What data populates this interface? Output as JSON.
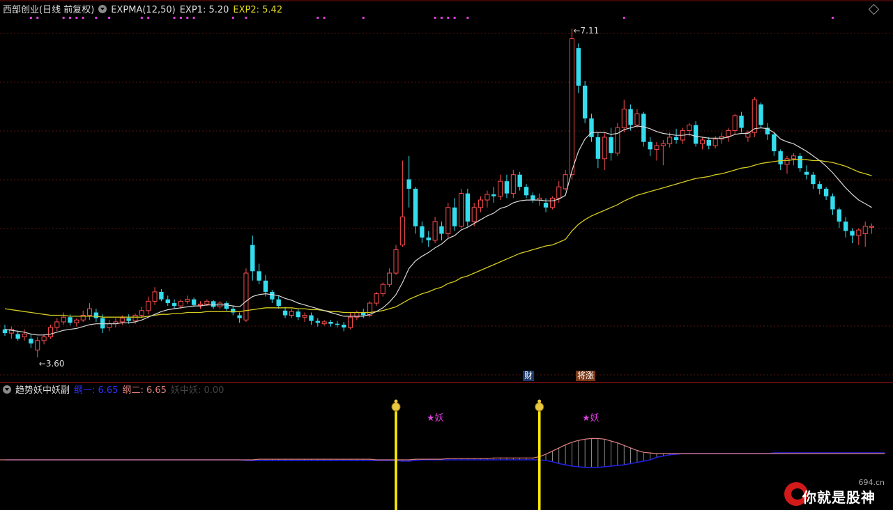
{
  "main_panel": {
    "title": "西部创业(日线 前复权)",
    "indicator_name": "EXPMA(12,50)",
    "exp1_label": "EXP1: 5.20",
    "exp2_label": "EXP2: 5.42",
    "high_label": "7.11",
    "low_label": "3.60",
    "tags": [
      {
        "text": "财"
      },
      {
        "text": "将涨"
      }
    ]
  },
  "sub_panel": {
    "title": "趋势妖中妖副",
    "line1_label": "纲一: 6.65",
    "line2_label": "纲二: 6.65",
    "line3_label": "妖中妖: 0.00",
    "signals": [
      {
        "text": "★妖"
      },
      {
        "text": "★妖"
      }
    ]
  },
  "watermark": {
    "text": "你就是股神",
    "site": "694.cn"
  },
  "colors": {
    "up": "#ff4d4d",
    "down": "#33ddee",
    "exp1": "#d8d8d8",
    "exp2": "#d4cc20",
    "signal": "#ffea00",
    "accent_magenta": "#e040e0",
    "line1": "#2020e0",
    "line2": "#e08080"
  },
  "icons": [
    "collapse-circle-icon",
    "diamond-icon",
    "money-bag-icon"
  ],
  "chart_data": {
    "type": "candlestick",
    "price_range": [
      3.4,
      7.25
    ],
    "candles": [
      [
        3.9,
        3.95,
        3.83,
        3.86
      ],
      [
        3.86,
        3.93,
        3.8,
        3.9
      ],
      [
        3.85,
        3.88,
        3.78,
        3.8
      ],
      [
        3.82,
        3.9,
        3.78,
        3.85
      ],
      [
        3.8,
        3.85,
        3.7,
        3.75
      ],
      [
        3.68,
        3.82,
        3.6,
        3.78
      ],
      [
        3.78,
        3.85,
        3.74,
        3.82
      ],
      [
        3.82,
        3.95,
        3.8,
        3.92
      ],
      [
        3.92,
        4.02,
        3.88,
        3.98
      ],
      [
        3.98,
        4.08,
        3.95,
        4.03
      ],
      [
        4.03,
        4.06,
        3.94,
        3.97
      ],
      [
        3.97,
        4.02,
        3.93,
        4.0
      ],
      [
        4.0,
        4.1,
        3.98,
        4.05
      ],
      [
        4.05,
        4.18,
        4.0,
        4.12
      ],
      [
        4.08,
        4.12,
        3.98,
        4.02
      ],
      [
        4.02,
        4.06,
        3.86,
        3.91
      ],
      [
        3.92,
        4.0,
        3.88,
        3.96
      ],
      [
        3.96,
        4.02,
        3.92,
        3.98
      ],
      [
        3.98,
        4.05,
        3.95,
        4.02
      ],
      [
        4.02,
        4.06,
        3.96,
        3.99
      ],
      [
        3.99,
        4.07,
        3.96,
        4.05
      ],
      [
        4.05,
        4.14,
        4.02,
        4.1
      ],
      [
        4.1,
        4.25,
        4.06,
        4.2
      ],
      [
        4.2,
        4.35,
        4.16,
        4.3
      ],
      [
        4.3,
        4.33,
        4.2,
        4.22
      ],
      [
        4.22,
        4.26,
        4.15,
        4.18
      ],
      [
        4.18,
        4.22,
        4.12,
        4.15
      ],
      [
        4.15,
        4.22,
        4.12,
        4.2
      ],
      [
        4.2,
        4.26,
        4.17,
        4.22
      ],
      [
        4.22,
        4.24,
        4.14,
        4.16
      ],
      [
        4.16,
        4.2,
        4.12,
        4.17
      ],
      [
        4.17,
        4.22,
        4.15,
        4.2
      ],
      [
        4.2,
        4.21,
        4.12,
        4.14
      ],
      [
        4.14,
        4.2,
        4.12,
        4.18
      ],
      [
        4.18,
        4.2,
        4.1,
        4.12
      ],
      [
        4.12,
        4.15,
        4.05,
        4.08
      ],
      [
        4.05,
        4.08,
        3.97,
        4.02
      ],
      [
        4.0,
        4.55,
        3.98,
        4.5
      ],
      [
        4.8,
        4.9,
        4.42,
        4.52
      ],
      [
        4.52,
        4.6,
        4.38,
        4.42
      ],
      [
        4.42,
        4.48,
        4.25,
        4.3
      ],
      [
        4.3,
        4.32,
        4.18,
        4.22
      ],
      [
        4.22,
        4.26,
        4.12,
        4.15
      ],
      [
        4.1,
        4.14,
        4.02,
        4.05
      ],
      [
        4.05,
        4.12,
        4.02,
        4.09
      ],
      [
        4.09,
        4.12,
        4.0,
        4.03
      ],
      [
        4.03,
        4.08,
        3.98,
        4.05
      ],
      [
        4.05,
        4.08,
        3.95,
        3.99
      ],
      [
        3.99,
        4.02,
        3.93,
        3.97
      ],
      [
        3.96,
        4.0,
        3.94,
        3.98
      ],
      [
        3.98,
        4.0,
        3.93,
        3.96
      ],
      [
        3.96,
        3.99,
        3.92,
        3.95
      ],
      [
        3.95,
        3.98,
        3.88,
        3.92
      ],
      [
        3.92,
        4.08,
        3.9,
        4.03
      ],
      [
        4.03,
        4.1,
        4.0,
        4.08
      ],
      [
        4.08,
        4.12,
        4.02,
        4.05
      ],
      [
        4.05,
        4.2,
        4.03,
        4.18
      ],
      [
        4.18,
        4.3,
        4.15,
        4.28
      ],
      [
        4.28,
        4.4,
        4.25,
        4.38
      ],
      [
        4.38,
        4.55,
        4.35,
        4.5
      ],
      [
        4.5,
        4.8,
        4.48,
        4.75
      ],
      [
        4.8,
        5.7,
        4.78,
        5.1
      ],
      [
        5.5,
        5.75,
        5.2,
        5.4
      ],
      [
        5.4,
        5.42,
        4.92,
        5.0
      ],
      [
        5.0,
        5.05,
        4.82,
        4.88
      ],
      [
        4.88,
        4.95,
        4.78,
        4.85
      ],
      [
        4.85,
        5.1,
        4.82,
        5.05
      ],
      [
        5.0,
        5.05,
        4.85,
        4.92
      ],
      [
        4.92,
        5.25,
        4.88,
        5.2
      ],
      [
        5.2,
        5.3,
        4.95,
        5.0
      ],
      [
        5.0,
        5.4,
        4.98,
        5.35
      ],
      [
        5.35,
        5.4,
        5.0,
        5.05
      ],
      [
        5.05,
        5.25,
        5.0,
        5.2
      ],
      [
        5.2,
        5.32,
        5.15,
        5.28
      ],
      [
        5.28,
        5.38,
        5.2,
        5.34
      ],
      [
        5.34,
        5.42,
        5.25,
        5.32
      ],
      [
        5.32,
        5.55,
        5.28,
        5.48
      ],
      [
        5.48,
        5.55,
        5.3,
        5.35
      ],
      [
        5.35,
        5.6,
        5.3,
        5.55
      ],
      [
        5.55,
        5.58,
        5.38,
        5.42
      ],
      [
        5.42,
        5.45,
        5.3,
        5.33
      ],
      [
        5.33,
        5.36,
        5.25,
        5.28
      ],
      [
        5.28,
        5.35,
        5.22,
        5.3
      ],
      [
        5.25,
        5.3,
        5.15,
        5.2
      ],
      [
        5.2,
        5.32,
        5.18,
        5.3
      ],
      [
        5.3,
        5.48,
        5.25,
        5.42
      ],
      [
        5.4,
        5.6,
        5.38,
        5.55
      ],
      [
        5.55,
        7.11,
        5.5,
        7.0
      ],
      [
        6.9,
        6.95,
        6.42,
        6.5
      ],
      [
        6.5,
        6.55,
        6.1,
        6.15
      ],
      [
        6.15,
        6.2,
        5.9,
        5.95
      ],
      [
        5.95,
        6.0,
        5.62,
        5.72
      ],
      [
        5.72,
        6.0,
        5.6,
        5.95
      ],
      [
        5.95,
        6.05,
        5.7,
        5.78
      ],
      [
        5.78,
        6.1,
        5.75,
        6.05
      ],
      [
        6.05,
        6.35,
        6.0,
        6.25
      ],
      [
        6.25,
        6.3,
        6.02,
        6.08
      ],
      [
        6.08,
        6.25,
        6.05,
        6.2
      ],
      [
        6.2,
        6.22,
        5.85,
        5.9
      ],
      [
        5.9,
        5.95,
        5.75,
        5.82
      ],
      [
        5.82,
        5.9,
        5.7,
        5.86
      ],
      [
        5.86,
        5.92,
        5.65,
        5.88
      ],
      [
        5.88,
        6.0,
        5.84,
        5.95
      ],
      [
        5.95,
        6.04,
        5.88,
        5.92
      ],
      [
        5.92,
        6.05,
        5.88,
        6.02
      ],
      [
        6.02,
        6.1,
        5.96,
        6.08
      ],
      [
        6.08,
        6.12,
        5.85,
        5.88
      ],
      [
        5.88,
        5.95,
        5.82,
        5.92
      ],
      [
        5.92,
        5.95,
        5.82,
        5.86
      ],
      [
        5.86,
        5.96,
        5.83,
        5.93
      ],
      [
        5.93,
        6.0,
        5.88,
        5.96
      ],
      [
        5.96,
        6.05,
        5.9,
        6.02
      ],
      [
        6.02,
        6.2,
        5.98,
        6.18
      ],
      [
        6.18,
        6.22,
        6.0,
        6.05
      ],
      [
        5.95,
        6.02,
        5.9,
        6.0
      ],
      [
        6.0,
        6.38,
        5.95,
        6.35
      ],
      [
        6.3,
        6.32,
        6.05,
        6.08
      ],
      [
        6.05,
        6.1,
        5.92,
        5.98
      ],
      [
        5.98,
        6.0,
        5.75,
        5.8
      ],
      [
        5.8,
        5.82,
        5.6,
        5.66
      ],
      [
        5.66,
        5.75,
        5.56,
        5.72
      ],
      [
        5.72,
        5.78,
        5.65,
        5.75
      ],
      [
        5.75,
        5.78,
        5.58,
        5.62
      ],
      [
        5.58,
        5.65,
        5.5,
        5.55
      ],
      [
        5.55,
        5.58,
        5.4,
        5.45
      ],
      [
        5.45,
        5.48,
        5.34,
        5.4
      ],
      [
        5.4,
        5.42,
        5.28,
        5.32
      ],
      [
        5.32,
        5.35,
        5.12,
        5.18
      ],
      [
        5.18,
        5.2,
        4.98,
        5.05
      ],
      [
        5.05,
        5.1,
        4.88,
        4.95
      ],
      [
        4.95,
        4.98,
        4.82,
        4.9
      ],
      [
        4.9,
        4.98,
        4.8,
        4.96
      ],
      [
        4.92,
        5.05,
        4.78,
        5.0
      ],
      [
        5.0,
        5.03,
        4.92,
        5.0
      ]
    ],
    "exp1": [
      3.9,
      3.89,
      3.88,
      3.87,
      3.85,
      3.84,
      3.84,
      3.85,
      3.87,
      3.89,
      3.9,
      3.91,
      3.93,
      3.95,
      3.96,
      3.96,
      3.96,
      3.96,
      3.97,
      3.97,
      3.98,
      4.0,
      4.03,
      4.06,
      4.09,
      4.11,
      4.12,
      4.13,
      4.14,
      4.15,
      4.15,
      4.16,
      4.16,
      4.16,
      4.16,
      4.15,
      4.14,
      4.2,
      4.25,
      4.27,
      4.28,
      4.27,
      4.26,
      4.23,
      4.21,
      4.18,
      4.16,
      4.14,
      4.12,
      4.1,
      4.08,
      4.06,
      4.04,
      4.04,
      4.04,
      4.04,
      4.06,
      4.09,
      4.13,
      4.19,
      4.27,
      4.4,
      4.55,
      4.63,
      4.68,
      4.72,
      4.77,
      4.81,
      4.87,
      4.9,
      4.96,
      4.99,
      5.03,
      5.07,
      5.11,
      5.14,
      5.19,
      5.21,
      5.25,
      5.27,
      5.28,
      5.28,
      5.28,
      5.27,
      5.27,
      5.29,
      5.33,
      5.59,
      5.8,
      5.93,
      6.0,
      6.0,
      6.0,
      5.98,
      5.99,
      6.03,
      6.05,
      6.07,
      6.06,
      6.04,
      6.01,
      5.99,
      5.98,
      5.97,
      5.97,
      5.98,
      5.96,
      5.95,
      5.94,
      5.94,
      5.94,
      5.95,
      5.98,
      5.99,
      5.99,
      6.04,
      6.05,
      6.04,
      6.0,
      5.93,
      5.9,
      5.88,
      5.84,
      5.8,
      5.75,
      5.7,
      5.64,
      5.57,
      5.49,
      5.41,
      5.34,
      5.28,
      5.24,
      5.2
    ],
    "exp2": [
      4.12,
      4.11,
      4.1,
      4.09,
      4.08,
      4.07,
      4.06,
      4.05,
      4.05,
      4.05,
      4.04,
      4.04,
      4.04,
      4.04,
      4.04,
      4.03,
      4.03,
      4.03,
      4.03,
      4.03,
      4.03,
      4.03,
      4.04,
      4.05,
      4.06,
      4.06,
      4.07,
      4.07,
      4.08,
      4.08,
      4.08,
      4.09,
      4.09,
      4.09,
      4.09,
      4.09,
      4.09,
      4.1,
      4.11,
      4.12,
      4.13,
      4.13,
      4.13,
      4.13,
      4.13,
      4.12,
      4.12,
      4.11,
      4.11,
      4.1,
      4.09,
      4.09,
      4.08,
      4.08,
      4.08,
      4.08,
      4.08,
      4.09,
      4.1,
      4.12,
      4.14,
      4.18,
      4.22,
      4.25,
      4.28,
      4.3,
      4.33,
      4.35,
      4.39,
      4.41,
      4.45,
      4.47,
      4.5,
      4.53,
      4.56,
      4.59,
      4.62,
      4.65,
      4.68,
      4.71,
      4.73,
      4.75,
      4.77,
      4.79,
      4.8,
      4.83,
      4.86,
      4.95,
      5.02,
      5.07,
      5.11,
      5.14,
      5.17,
      5.2,
      5.23,
      5.27,
      5.3,
      5.33,
      5.35,
      5.37,
      5.39,
      5.41,
      5.43,
      5.45,
      5.47,
      5.49,
      5.51,
      5.52,
      5.53,
      5.55,
      5.56,
      5.58,
      5.6,
      5.62,
      5.63,
      5.65,
      5.67,
      5.68,
      5.69,
      5.7,
      5.7,
      5.71,
      5.71,
      5.71,
      5.7,
      5.7,
      5.69,
      5.68,
      5.66,
      5.64,
      5.61,
      5.58,
      5.56,
      5.54
    ],
    "top_markers": [
      4,
      5,
      9,
      10,
      11,
      12,
      14,
      16,
      21,
      22,
      26,
      27,
      28,
      29,
      35,
      37,
      48,
      49,
      55,
      66,
      67,
      68,
      69,
      71,
      95,
      127
    ],
    "signal_bars": [
      60,
      82
    ],
    "sub_line1": [
      0,
      0,
      0,
      0,
      0,
      0,
      0,
      0,
      0,
      0,
      0,
      0,
      0,
      0,
      0,
      0,
      0,
      0,
      0,
      0,
      0,
      0,
      0,
      0,
      0,
      0,
      0,
      0,
      0,
      0,
      0,
      0,
      0,
      0,
      0,
      0,
      0,
      -0.1,
      -0.1,
      -0.1,
      -0.1,
      -0.1,
      -0.1,
      -0.1,
      -0.1,
      -0.1,
      -0.1,
      -0.1,
      -0.1,
      -0.1,
      -0.1,
      -0.1,
      -0.1,
      -0.1,
      -0.1,
      -0.1,
      -0.1,
      -0.1,
      -0.1,
      -0.1,
      -0.1,
      -0.2,
      -0.2,
      -0.1,
      0,
      0,
      0,
      0,
      0,
      0,
      0,
      0,
      0,
      0,
      0,
      0,
      0,
      0,
      0,
      0,
      0,
      0,
      0,
      -0.1,
      -0.3,
      -0.6,
      -0.8,
      -1.0,
      -1.1,
      -1.2,
      -1.2,
      -1.2,
      -1.1,
      -1.0,
      -0.9,
      -0.8,
      -0.6,
      -0.4,
      -0.2,
      0,
      0.4,
      0.6,
      0.8,
      0.9,
      1.0,
      1.0,
      1.0,
      1.0,
      1.0,
      1.0,
      1.0,
      1.0,
      1.0,
      1.0,
      1.0,
      1.0,
      1.0,
      1.0,
      1.1,
      1.1,
      1.1,
      1.1,
      1.1,
      1.1,
      1.1,
      1.1,
      1.1,
      1.1,
      1.1,
      1.1,
      1.1,
      1.1,
      1.1,
      1.1,
      1.1,
      1.1
    ],
    "sub_line2": [
      0,
      0,
      0,
      0,
      0,
      0,
      0,
      0,
      0,
      0,
      0,
      0,
      0,
      0,
      0,
      0,
      0,
      0,
      0,
      0,
      0,
      0,
      0,
      0,
      0,
      0,
      0,
      0,
      0,
      0,
      0,
      0,
      0,
      0,
      0,
      0,
      0,
      0,
      0,
      0.1,
      0.1,
      0.1,
      0.1,
      0.1,
      0.1,
      0.1,
      0.1,
      0.1,
      0.1,
      0.1,
      0.1,
      0.1,
      0.1,
      0.1,
      0.1,
      0.1,
      0.1,
      0,
      0,
      0,
      0,
      0,
      0,
      0.1,
      0.1,
      0.1,
      0.1,
      0.1,
      0.2,
      0.2,
      0.2,
      0.2,
      0.2,
      0.2,
      0.2,
      0.3,
      0.3,
      0.3,
      0.3,
      0.3,
      0.3,
      0.3,
      0.5,
      0.9,
      1.4,
      1.9,
      2.4,
      2.8,
      3.1,
      3.3,
      3.4,
      3.4,
      3.3,
      3.0,
      2.7,
      2.3,
      1.9,
      1.5,
      1.2,
      1.1,
      1.0,
      1.0,
      1.0,
      1.0,
      1.0,
      1.0,
      1.0,
      1.0,
      1.0,
      1.0,
      1.0,
      1.0,
      1.0,
      1.0,
      1.0,
      1.0,
      1.0,
      1.0,
      1.0,
      1.0,
      1.0,
      1.0,
      1.0,
      1.0,
      1.0,
      1.0,
      1.0,
      1.0,
      1.0,
      1.0,
      1.0,
      1.0,
      1.0,
      1.0,
      1.0,
      1.0
    ]
  }
}
